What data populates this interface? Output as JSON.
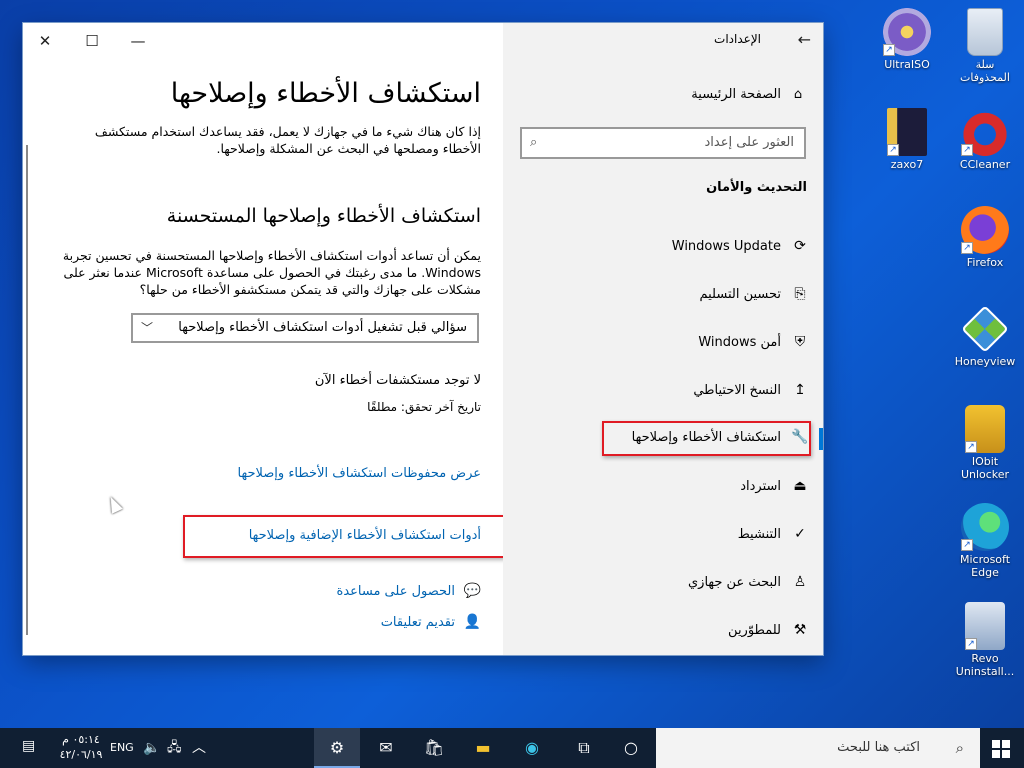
{
  "desktop": {
    "icons": [
      {
        "label": "UltraISO",
        "icon": "ultraiso-icon"
      },
      {
        "label": "سلة\nالمحذوفات",
        "icon": "recycle-bin-icon"
      },
      {
        "label": "zaxo7",
        "icon": "folder-icon"
      },
      {
        "label": "CCleaner",
        "icon": "ccleaner-icon"
      },
      {
        "label": "Firefox",
        "icon": "firefox-icon"
      },
      {
        "label": "Honeyview",
        "icon": "honeyview-icon"
      },
      {
        "label": "IObit\nUnlocker",
        "icon": "iobit-unlocker-icon"
      },
      {
        "label": "Microsoft\nEdge",
        "icon": "edge-icon"
      },
      {
        "label": "Revo\nUninstall...",
        "icon": "revo-uninstaller-icon"
      }
    ]
  },
  "window": {
    "controls": {
      "minimize": "—",
      "maximize": "☐",
      "close": "✕"
    },
    "main": {
      "title": "استكشاف الأخطاء وإصلاحها",
      "intro": "إذا كان هناك شيء ما في جهازك لا يعمل، فقد يساعدك استخدام مستكشف الأخطاء ومصلحها في البحث عن المشكلة وإصلاحها.",
      "recommended_heading": "استكشاف الأخطاء وإصلاحها المستحسنة",
      "recommended_text": "يمكن أن تساعد أدوات استكشاف الأخطاء وإصلاحها المستحسنة في تحسين تجربة Windows. ما مدى رغبتك في الحصول على مساعدة Microsoft عندما نعثر على مشكلات على جهازك والتي قد يتمكن مستكشفو الأخطاء من حلها؟",
      "select_value": "سؤالي قبل تشغيل أدوات استكشاف الأخطاء وإصلاحها",
      "status_none": "لا توجد مستكشفات أخطاء الآن",
      "last_checked": "تاريخ آخر تحقق: مطلقًا",
      "link_history": "عرض محفوظات استكشاف الأخطاء وإصلاحها",
      "link_additional": "أدوات استكشاف الأخطاء الإضافية وإصلاحها",
      "help": "الحصول على مساعدة",
      "feedback": "تقديم تعليقات"
    },
    "nav": {
      "app_title": "الإعدادات",
      "back": "←",
      "home": "الصفحة الرئيسية",
      "search_placeholder": "العثور على إعداد",
      "section": "التحديث والأمان",
      "items": [
        {
          "label": "Windows Update",
          "icon": "refresh-icon"
        },
        {
          "label": "تحسين التسليم",
          "icon": "delivery-icon"
        },
        {
          "label": "أمن Windows",
          "icon": "shield-icon"
        },
        {
          "label": "النسخ الاحتياطي",
          "icon": "backup-icon"
        },
        {
          "label": "استكشاف الأخطاء وإصلاحها",
          "icon": "wrench-icon",
          "selected": true
        },
        {
          "label": "استرداد",
          "icon": "recovery-icon"
        },
        {
          "label": "التنشيط",
          "icon": "check-circle-icon"
        },
        {
          "label": "البحث عن جهازي",
          "icon": "find-device-icon"
        },
        {
          "label": "للمطوّرين",
          "icon": "developer-icon"
        }
      ]
    }
  },
  "taskbar": {
    "search_placeholder": "اكتب هنا للبحث",
    "language": "ENG",
    "time": "٠٥:١٤ م",
    "date": "٤٢/٠٦/١٩",
    "accent": "#0078d7"
  }
}
